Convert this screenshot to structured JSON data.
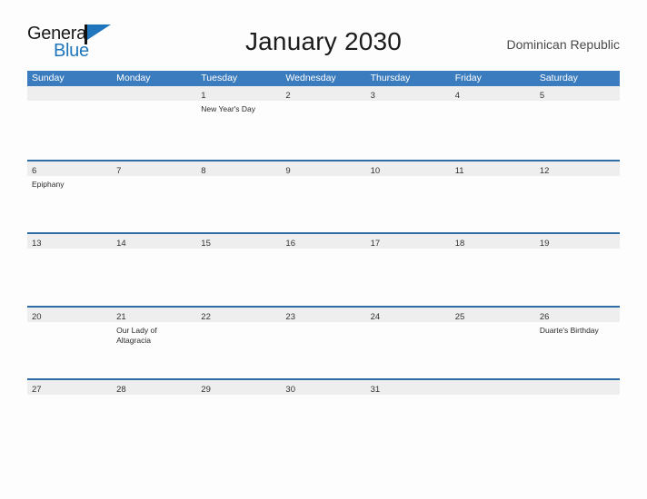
{
  "brand": {
    "name_part1": "General",
    "name_part2": "Blue",
    "flag_icon": "flag-triangle-icon"
  },
  "header": {
    "title": "January 2030",
    "region": "Dominican Republic"
  },
  "calendar": {
    "weekdays": [
      "Sunday",
      "Monday",
      "Tuesday",
      "Wednesday",
      "Thursday",
      "Friday",
      "Saturday"
    ],
    "accent_color": "#3b7cbe",
    "rule_color": "#2e6da4",
    "day_band_color": "#eeeeee",
    "weeks": [
      [
        {
          "date": "",
          "event": ""
        },
        {
          "date": "",
          "event": ""
        },
        {
          "date": "1",
          "event": "New Year's Day"
        },
        {
          "date": "2",
          "event": ""
        },
        {
          "date": "3",
          "event": ""
        },
        {
          "date": "4",
          "event": ""
        },
        {
          "date": "5",
          "event": ""
        }
      ],
      [
        {
          "date": "6",
          "event": "Epiphany"
        },
        {
          "date": "7",
          "event": ""
        },
        {
          "date": "8",
          "event": ""
        },
        {
          "date": "9",
          "event": ""
        },
        {
          "date": "10",
          "event": ""
        },
        {
          "date": "11",
          "event": ""
        },
        {
          "date": "12",
          "event": ""
        }
      ],
      [
        {
          "date": "13",
          "event": ""
        },
        {
          "date": "14",
          "event": ""
        },
        {
          "date": "15",
          "event": ""
        },
        {
          "date": "16",
          "event": ""
        },
        {
          "date": "17",
          "event": ""
        },
        {
          "date": "18",
          "event": ""
        },
        {
          "date": "19",
          "event": ""
        }
      ],
      [
        {
          "date": "20",
          "event": ""
        },
        {
          "date": "21",
          "event": "Our Lady of Altagracia"
        },
        {
          "date": "22",
          "event": ""
        },
        {
          "date": "23",
          "event": ""
        },
        {
          "date": "24",
          "event": ""
        },
        {
          "date": "25",
          "event": ""
        },
        {
          "date": "26",
          "event": "Duarte's Birthday"
        }
      ],
      [
        {
          "date": "27",
          "event": ""
        },
        {
          "date": "28",
          "event": ""
        },
        {
          "date": "29",
          "event": ""
        },
        {
          "date": "30",
          "event": ""
        },
        {
          "date": "31",
          "event": ""
        },
        {
          "date": "",
          "event": ""
        },
        {
          "date": "",
          "event": ""
        }
      ]
    ]
  }
}
